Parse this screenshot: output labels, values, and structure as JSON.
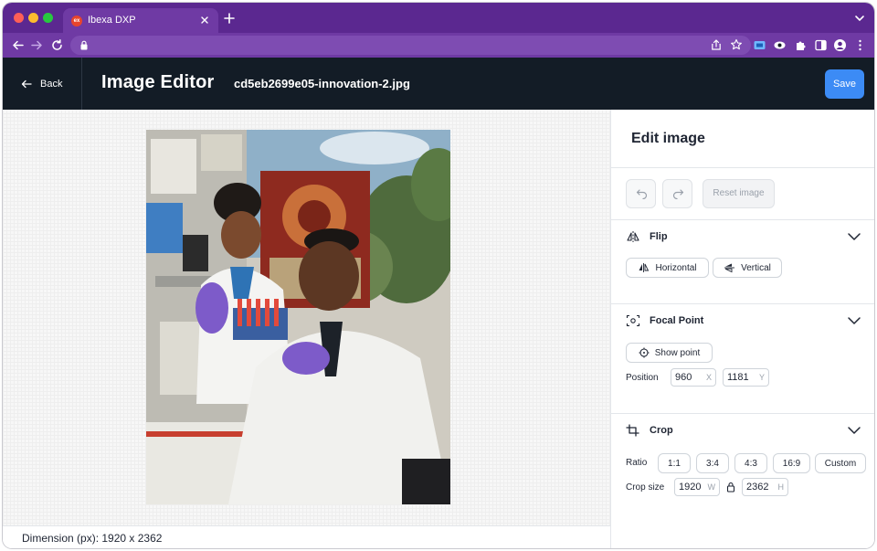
{
  "browser": {
    "tab_title": "Ibexa DXP",
    "tab_favicon_text": "ex"
  },
  "header": {
    "back_label": "Back",
    "title": "Image Editor",
    "file_name": "cd5eb2699e05-innovation-2.jpg",
    "save_label": "Save"
  },
  "canvas": {
    "dimension_text": "Dimension (px): 1920 x 2362"
  },
  "panel": {
    "title": "Edit image",
    "reset_label": "Reset image",
    "flip": {
      "title": "Flip",
      "horizontal_label": "Horizontal",
      "vertical_label": "Vertical"
    },
    "focal_point": {
      "title": "Focal Point",
      "show_point_label": "Show point",
      "position_label": "Position",
      "x_value": "960",
      "x_suffix": "X",
      "y_value": "1181",
      "y_suffix": "Y"
    },
    "crop": {
      "title": "Crop",
      "ratio_label": "Ratio",
      "ratios": [
        "1:1",
        "3:4",
        "4:3",
        "16:9",
        "Custom"
      ],
      "size_label": "Crop size",
      "width_value": "1920",
      "width_suffix": "W",
      "height_value": "2362",
      "height_suffix": "H"
    }
  },
  "colors": {
    "browser_frame": "#5b2890",
    "app_header": "#131c26",
    "accent": "#3c8bf5"
  }
}
